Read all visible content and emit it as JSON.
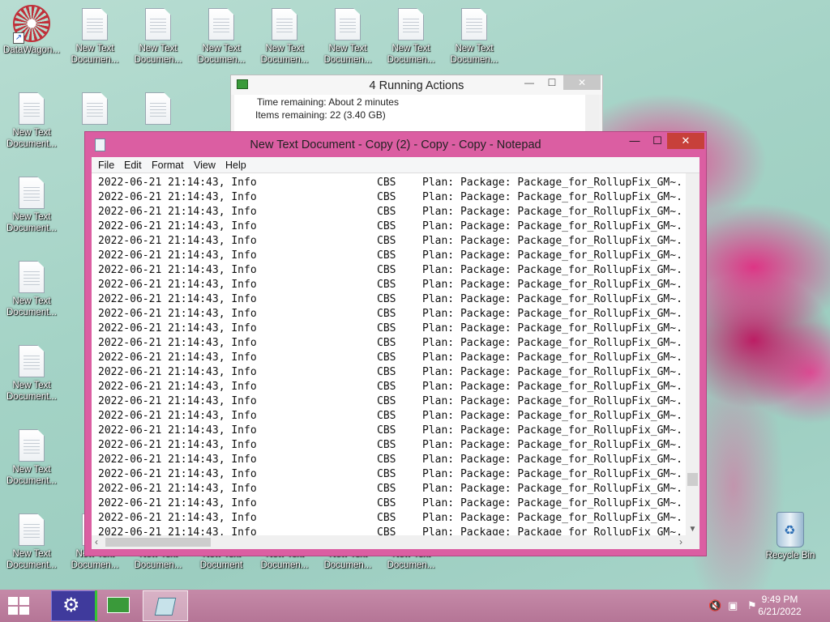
{
  "desktop": {
    "icons": [
      {
        "label": "DataWagon...",
        "kind": "app"
      },
      {
        "label": "New Text\nDocumen...",
        "kind": "file"
      },
      {
        "label": "Recycle Bin",
        "kind": "recycle"
      }
    ],
    "text_doc_label": "New Text\nDocumen...",
    "text_doc_label_alt": "New Text\nDocument...",
    "text_doc_label_full": "New Text\nDocument"
  },
  "running_actions": {
    "title": "4 Running Actions",
    "time_label": "Time remaining:",
    "time_value": "About 2 minutes",
    "items_label": "Items remaining:",
    "items_value": "22 (3.40 GB)",
    "minimize": "—",
    "maximize": "☐",
    "close": "✕"
  },
  "notepad": {
    "title": "New Text Document - Copy (2) - Copy - Copy - Notepad",
    "menu": [
      "File",
      "Edit",
      "Format",
      "View",
      "Help"
    ],
    "minimize": "—",
    "maximize": "☐",
    "close": "✕",
    "lines": [
      {
        "ts": "2022-06-21 21:14:43, Info",
        "src": "CBS",
        "msg": "Plan: Package: Package_for_RollupFix_GM~."
      },
      {
        "ts": "2022-06-21 21:14:43, Info",
        "src": "CBS",
        "msg": "Plan: Package: Package_for_RollupFix_GM~."
      },
      {
        "ts": "2022-06-21 21:14:43, Info",
        "src": "CBS",
        "msg": "Plan: Package: Package_for_RollupFix_GM~."
      },
      {
        "ts": "2022-06-21 21:14:43, Info",
        "src": "CBS",
        "msg": "Plan: Package: Package_for_RollupFix_GM~."
      },
      {
        "ts": "2022-06-21 21:14:43, Info",
        "src": "CBS",
        "msg": "Plan: Package: Package_for_RollupFix_GM~."
      },
      {
        "ts": "2022-06-21 21:14:43, Info",
        "src": "CBS",
        "msg": "Plan: Package: Package_for_RollupFix_GM~."
      },
      {
        "ts": "2022-06-21 21:14:43, Info",
        "src": "CBS",
        "msg": "Plan: Package: Package_for_RollupFix_GM~."
      },
      {
        "ts": "2022-06-21 21:14:43, Info",
        "src": "CBS",
        "msg": "Plan: Package: Package_for_RollupFix_GM~."
      },
      {
        "ts": "2022-06-21 21:14:43, Info",
        "src": "CBS",
        "msg": "Plan: Package: Package_for_RollupFix_GM~."
      },
      {
        "ts": "2022-06-21 21:14:43, Info",
        "src": "CBS",
        "msg": "Plan: Package: Package_for_RollupFix_GM~."
      },
      {
        "ts": "2022-06-21 21:14:43, Info",
        "src": "CBS",
        "msg": "Plan: Package: Package_for_RollupFix_GM~."
      },
      {
        "ts": "2022-06-21 21:14:43, Info",
        "src": "CBS",
        "msg": "Plan: Package: Package_for_RollupFix_GM~."
      },
      {
        "ts": "2022-06-21 21:14:43, Info",
        "src": "CBS",
        "msg": "Plan: Package: Package_for_RollupFix_GM~."
      },
      {
        "ts": "2022-06-21 21:14:43, Info",
        "src": "CBS",
        "msg": "Plan: Package: Package_for_RollupFix_GM~."
      },
      {
        "ts": "2022-06-21 21:14:43, Info",
        "src": "CBS",
        "msg": "Plan: Package: Package_for_RollupFix_GM~."
      },
      {
        "ts": "2022-06-21 21:14:43, Info",
        "src": "CBS",
        "msg": "Plan: Package: Package_for_RollupFix_GM~."
      },
      {
        "ts": "2022-06-21 21:14:43, Info",
        "src": "CBS",
        "msg": "Plan: Package: Package_for_RollupFix_GM~."
      },
      {
        "ts": "2022-06-21 21:14:43, Info",
        "src": "CBS",
        "msg": "Plan: Package: Package_for_RollupFix_GM~."
      },
      {
        "ts": "2022-06-21 21:14:43, Info",
        "src": "CBS",
        "msg": "Plan: Package: Package_for_RollupFix_GM~."
      },
      {
        "ts": "2022-06-21 21:14:43, Info",
        "src": "CBS",
        "msg": "Plan: Package: Package_for_RollupFix_GM~."
      },
      {
        "ts": "2022-06-21 21:14:43, Info",
        "src": "CBS",
        "msg": "Plan: Package: Package_for_RollupFix_GM~."
      },
      {
        "ts": "2022-06-21 21:14:43, Info",
        "src": "CBS",
        "msg": "Plan: Package: Package_for_RollupFix_GM~."
      },
      {
        "ts": "2022-06-21 21:14:43, Info",
        "src": "CBS",
        "msg": "Plan: Package: Package_for_RollupFix_GM~."
      },
      {
        "ts": "2022-06-21 21:14:43, Info",
        "src": "CBS",
        "msg": "Plan: Package: Package_for_RollupFix_GM~."
      },
      {
        "ts": "2022-06-21 21:14:43, Info",
        "src": "CBS",
        "msg": "Plan: Package: Package_for_RollupFix_GM~."
      }
    ]
  },
  "taskbar": {
    "time": "9:49 PM",
    "date": "6/21/2022",
    "settings_icon": "gear-icon",
    "tray": [
      "speaker-muted-icon",
      "network-icon",
      "flag-icon"
    ]
  },
  "colors": {
    "accent": "#db5ea2",
    "close_red": "#c7403a",
    "taskbar": "#b57596"
  }
}
